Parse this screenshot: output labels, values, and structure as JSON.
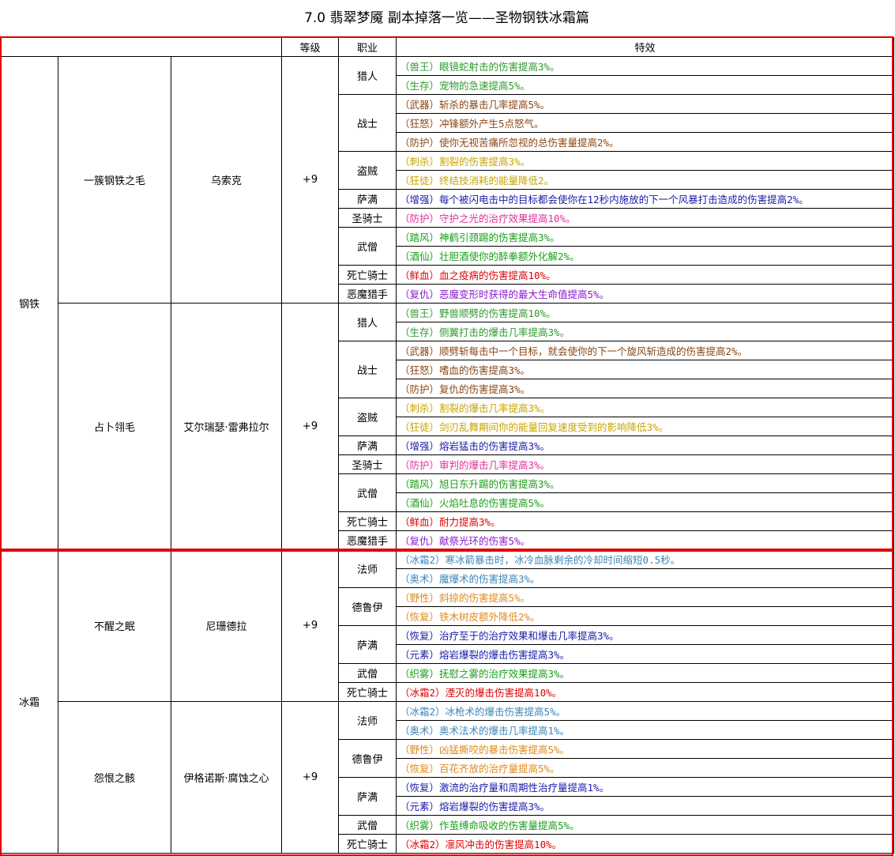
{
  "title": "7.0 翡翠梦魇 副本掉落一览——圣物钢铁冰霜篇",
  "headers": {
    "level": "等级",
    "class": "职业",
    "effect": "特效"
  },
  "colors": {
    "hunter": "#2e9a2e",
    "warrior": "#8b4513",
    "rogue": "#c8a400",
    "shaman": "#1a1aaa",
    "paladin": "#e0309a",
    "monk": "#1a9e1a",
    "dk": "#e00000",
    "dh": "#8a1acc",
    "mage": "#3d86b8",
    "druid": "#e08a1a"
  },
  "groups": [
    {
      "type": "钢铁",
      "relics": [
        {
          "name": "一簇钢铁之毛",
          "boss": "乌索克",
          "level": "+9",
          "classes": [
            {
              "name": "猎人",
              "effects": [
                {
                  "text": "（兽王）眼镜蛇射击的伤害提高3%。",
                  "color": "#2e9a2e"
                },
                {
                  "text": "（生存）宠物的急速提高5%。",
                  "color": "#2e9a2e"
                }
              ]
            },
            {
              "name": "战士",
              "effects": [
                {
                  "text": "（武器）斩杀的暴击几率提高5%。",
                  "color": "#8b4513"
                },
                {
                  "text": "（狂怒）冲锋额外产生5点怒气。",
                  "color": "#8b4513"
                },
                {
                  "text": "（防护）使你无视苦痛所忽视的总伤害量提高2%。",
                  "color": "#8b4513"
                }
              ]
            },
            {
              "name": "盗贼",
              "effects": [
                {
                  "text": "（刺杀）割裂的伤害提高3%。",
                  "color": "#c8a400"
                },
                {
                  "text": "（狂徒）终结技消耗的能量降低2。",
                  "color": "#c8a400"
                }
              ]
            },
            {
              "name": "萨满",
              "effects": [
                {
                  "text": "（增强）每个被闪电击中的目标都会使你在12秒内施放的下一个风暴打击造成的伤害提高2%。",
                  "color": "#1a1aaa"
                }
              ]
            },
            {
              "name": "圣骑士",
              "effects": [
                {
                  "text": "（防护）守护之光的治疗效果提高10%。",
                  "color": "#e0309a"
                }
              ]
            },
            {
              "name": "武僧",
              "effects": [
                {
                  "text": "（踏风）神鹤引颈踢的伤害提高3%。",
                  "color": "#1a9e1a"
                },
                {
                  "text": "（酒仙）壮胆酒使你的醉拳额外化解2%。",
                  "color": "#1a9e1a"
                }
              ]
            },
            {
              "name": "死亡骑士",
              "effects": [
                {
                  "text": "（鲜血）血之疫病的伤害提高10%。",
                  "color": "#e00000"
                }
              ]
            },
            {
              "name": "恶魔猎手",
              "effects": [
                {
                  "text": "（复仇）恶魔变形时获得的最大生命值提高5%。",
                  "color": "#8a1acc"
                }
              ]
            }
          ]
        },
        {
          "name": "占卜翎毛",
          "boss": "艾尔瑞瑟·雷弗拉尔",
          "level": "+9",
          "classes": [
            {
              "name": "猎人",
              "effects": [
                {
                  "text": "（兽王）野兽顺劈的伤害提高10%。",
                  "color": "#2e9a2e"
                },
                {
                  "text": "（生存）侧翼打击的爆击几率提高3%。",
                  "color": "#2e9a2e"
                }
              ]
            },
            {
              "name": "战士",
              "effects": [
                {
                  "text": "（武器）顺劈斩每击中一个目标，就会使你的下一个旋风斩造成的伤害提高2%。",
                  "color": "#8b4513"
                },
                {
                  "text": "（狂怒）嗜血的伤害提高3%。",
                  "color": "#8b4513"
                },
                {
                  "text": "（防护）复仇的伤害提高3%。",
                  "color": "#8b4513"
                }
              ]
            },
            {
              "name": "盗贼",
              "effects": [
                {
                  "text": "（刺杀）割裂的爆击几率提高3%。",
                  "color": "#c8a400"
                },
                {
                  "text": "（狂徒）剑刃乱舞期间你的能量回复速度受到的影响降低3%。",
                  "color": "#c8a400"
                }
              ]
            },
            {
              "name": "萨满",
              "effects": [
                {
                  "text": "（增强）熔岩猛击的伤害提高3%。",
                  "color": "#1a1aaa"
                }
              ]
            },
            {
              "name": "圣骑士",
              "effects": [
                {
                  "text": "（防护）审判的爆击几率提高3%。",
                  "color": "#e0309a"
                }
              ]
            },
            {
              "name": "武僧",
              "effects": [
                {
                  "text": "（踏风）旭日东升踢的伤害提高3%。",
                  "color": "#1a9e1a"
                },
                {
                  "text": "（酒仙）火焰吐息的伤害提高5%。",
                  "color": "#1a9e1a"
                }
              ]
            },
            {
              "name": "死亡骑士",
              "effects": [
                {
                  "text": "（鲜血）耐力提高3%。",
                  "color": "#e00000"
                }
              ]
            },
            {
              "name": "恶魔猎手",
              "effects": [
                {
                  "text": "（复仇）献祭光环的伤害5%。",
                  "color": "#8a1acc"
                }
              ]
            }
          ]
        }
      ]
    },
    {
      "type": "冰霜",
      "relics": [
        {
          "name": "不醒之眠",
          "boss": "尼珊德拉",
          "level": "+9",
          "classes": [
            {
              "name": "法师",
              "effects": [
                {
                  "text": "（冰霜2）寒冰箭暴击时，冰冷血脉剩余的冷却时间缩短0.5秒。",
                  "color": "#3d86b8"
                },
                {
                  "text": "（奥术）魔爆术的伤害提高3%。",
                  "color": "#3d86b8"
                }
              ]
            },
            {
              "name": "德鲁伊",
              "effects": [
                {
                  "text": "（野性）斜掠的伤害提高5%。",
                  "color": "#e08a1a"
                },
                {
                  "text": "（恢复）铁木树皮额外降低2%。",
                  "color": "#e08a1a"
                }
              ]
            },
            {
              "name": "萨满",
              "effects": [
                {
                  "text": "（恢复）治疗至于的治疗效果和爆击几率提高3%。",
                  "color": "#1a1aaa"
                },
                {
                  "text": "（元素）熔岩爆裂的爆击伤害提高3%。",
                  "color": "#1a1aaa"
                }
              ]
            },
            {
              "name": "武僧",
              "effects": [
                {
                  "text": "（织雾）抚慰之雾的治疗效果提高3%。",
                  "color": "#1a9e1a"
                }
              ]
            },
            {
              "name": "死亡骑士",
              "effects": [
                {
                  "text": "（冰霜2）湮灭的爆击伤害提高10%。",
                  "color": "#e00000"
                }
              ]
            }
          ]
        },
        {
          "name": "怨恨之骸",
          "boss": "伊格诺斯·腐蚀之心",
          "level": "+9",
          "classes": [
            {
              "name": "法师",
              "effects": [
                {
                  "text": "（冰霜2）冰枪术的爆击伤害提高5%。",
                  "color": "#3d86b8"
                },
                {
                  "text": "（奥术）奥术法术的爆击几率提高1%。",
                  "color": "#3d86b8"
                }
              ]
            },
            {
              "name": "德鲁伊",
              "effects": [
                {
                  "text": "（野性）凶猛撕咬的暴击伤害提高5%。",
                  "color": "#e08a1a"
                },
                {
                  "text": "（恢复）百花齐放的治疗量提高5%。",
                  "color": "#e08a1a"
                }
              ]
            },
            {
              "name": "萨满",
              "effects": [
                {
                  "text": "（恢复）激流的治疗量和周期性治疗量提高1%。",
                  "color": "#1a1aaa"
                },
                {
                  "text": "（元素）熔岩爆裂的伤害提高3%。",
                  "color": "#1a1aaa"
                }
              ]
            },
            {
              "name": "武僧",
              "effects": [
                {
                  "text": "（织雾）作茧缚命吸收的伤害量提高5%。",
                  "color": "#1a9e1a"
                }
              ]
            },
            {
              "name": "死亡骑士",
              "effects": [
                {
                  "text": "（冰霜2）凛风冲击的伤害提高10%。",
                  "color": "#e00000"
                }
              ]
            }
          ]
        }
      ]
    }
  ]
}
